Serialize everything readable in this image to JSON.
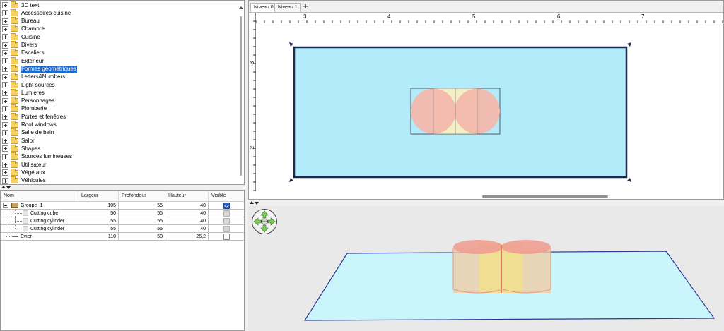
{
  "catalog": {
    "items": [
      {
        "label": "3D text",
        "selected": false
      },
      {
        "label": "Accessoires cuisine",
        "selected": false
      },
      {
        "label": "Bureau",
        "selected": false
      },
      {
        "label": "Chambre",
        "selected": false
      },
      {
        "label": "Cuisine",
        "selected": false
      },
      {
        "label": "Divers",
        "selected": false
      },
      {
        "label": "Escaliers",
        "selected": false
      },
      {
        "label": "Extérieur",
        "selected": false
      },
      {
        "label": "Formes géométriques",
        "selected": true
      },
      {
        "label": "Letters&Numbers",
        "selected": false
      },
      {
        "label": "Light sources",
        "selected": false
      },
      {
        "label": "Lumières",
        "selected": false
      },
      {
        "label": "Personnages",
        "selected": false
      },
      {
        "label": "Plomberie",
        "selected": false
      },
      {
        "label": "Portes et fenêtres",
        "selected": false
      },
      {
        "label": "Roof windows",
        "selected": false
      },
      {
        "label": "Salle de bain",
        "selected": false
      },
      {
        "label": "Salon",
        "selected": false
      },
      {
        "label": "Shapes",
        "selected": false
      },
      {
        "label": "Sources lumineuses",
        "selected": false
      },
      {
        "label": "Utilisateur",
        "selected": false
      },
      {
        "label": "Végétaux",
        "selected": false
      },
      {
        "label": "Véhicules",
        "selected": false
      }
    ]
  },
  "furniture_table": {
    "headers": {
      "name": "Nom",
      "width": "Largeur",
      "depth": "Profondeur",
      "height": "Hauteur",
      "visible": "Visible"
    },
    "rows": [
      {
        "name": "Groupe -1-",
        "width": "105",
        "depth": "55",
        "height": "40",
        "visible": true
      },
      {
        "name": "Cutting cube",
        "width": "50",
        "depth": "55",
        "height": "40",
        "visible": true
      },
      {
        "name": "Cutting cylinder",
        "width": "55",
        "depth": "55",
        "height": "40",
        "visible": true
      },
      {
        "name": "Cutting cylinder",
        "width": "55",
        "depth": "55",
        "height": "40",
        "visible": true
      },
      {
        "name": "Evier",
        "width": "110",
        "depth": "58",
        "height": "26,2",
        "visible": false
      }
    ]
  },
  "plan": {
    "levels": [
      {
        "label": "Niveau 0",
        "active": true
      },
      {
        "label": "Niveau 1",
        "active": false
      }
    ],
    "add_level": "+",
    "ruler_x": [
      "3",
      "4",
      "5",
      "6",
      "7"
    ],
    "ruler_y": [
      "-3",
      "-2"
    ]
  },
  "colors": {
    "selection": "#1b6ac9",
    "room_fill": "#b2ebf9",
    "floor3d": "#c9f5fb",
    "shape_fill": "#f3b8ac",
    "cube_fill": "#f3f0c6"
  }
}
